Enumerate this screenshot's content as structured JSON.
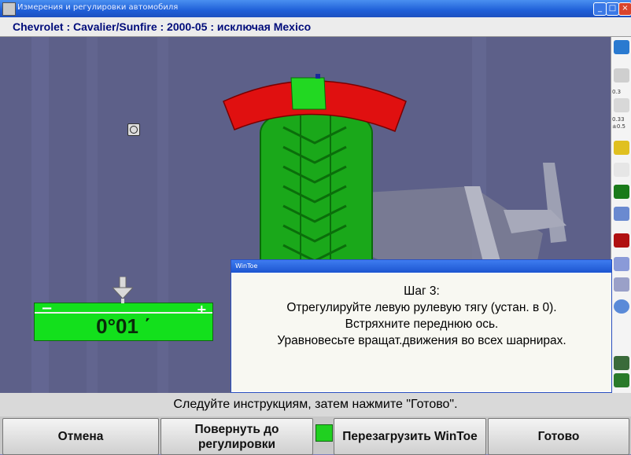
{
  "window": {
    "title": "Измерения и регулировки автомобиля"
  },
  "vehicle": {
    "label": "Chevrolet : Cavalier/Sunfire : 2000-05 : исключая Mexico"
  },
  "sidebar": {
    "value_1": "0.3",
    "value_2": "0.33",
    "value_3": "±0.5"
  },
  "gauge": {
    "minus": "−",
    "plus": "+",
    "value": "0°01 ΄"
  },
  "dialog": {
    "title": "WinToe",
    "step": "Шаг 3:",
    "line1": "Отрегулируйте левую рулевую тягу (устан. в 0).",
    "line2": "Встряхните переднюю ось.",
    "line3": "Уравновесьте вращат.движения во всех шарнирах."
  },
  "status": {
    "text": "Следуйте инструкциям, затем нажмите \"Готово\"."
  },
  "buttons": {
    "cancel": "Отмена",
    "rotate": "Повернуть до регулировки",
    "reload": "Перезагрузить WinToe",
    "done": "Готово"
  },
  "colors": {
    "ring_red": "#e01010",
    "tire_green": "#18b018",
    "gauge_green": "#13e01c",
    "indicator_green": "#20d020"
  }
}
